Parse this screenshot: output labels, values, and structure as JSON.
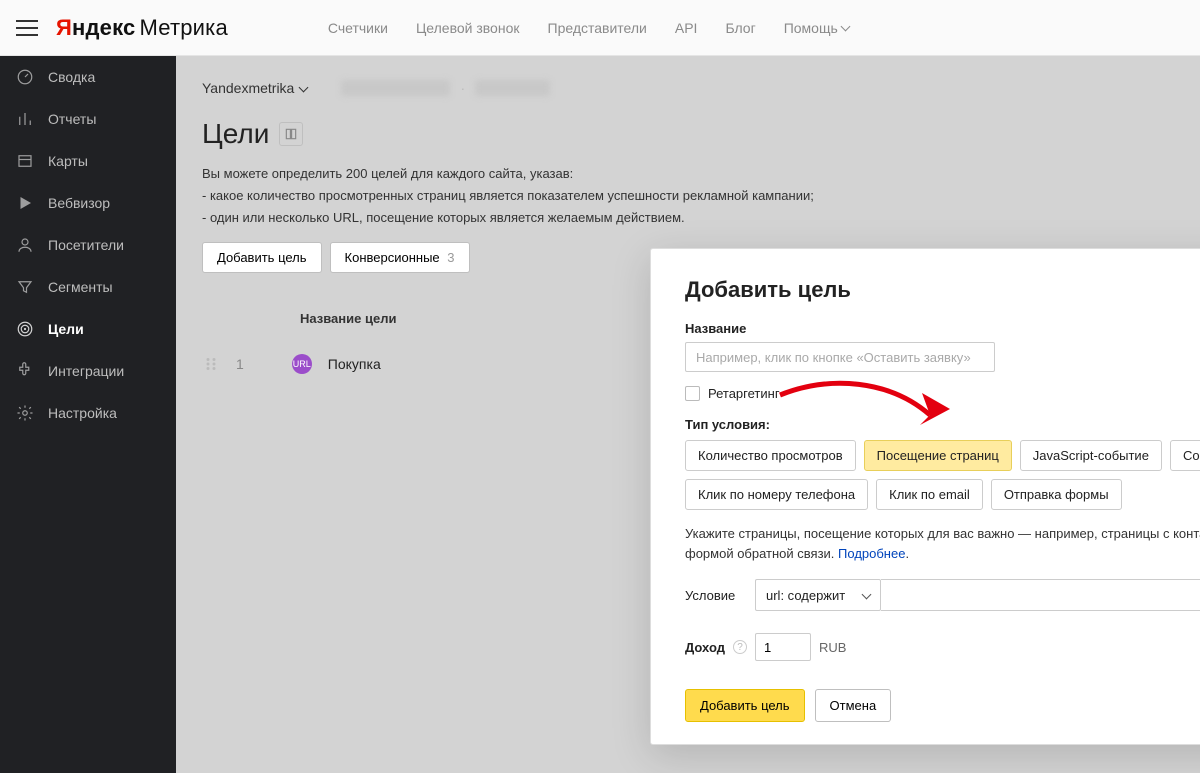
{
  "logo": {
    "y": "Я",
    "andex": "ндекс",
    "metrika": "Метрика"
  },
  "topnav": {
    "counters": "Счетчики",
    "target_call": "Целевой звонок",
    "reps": "Представители",
    "api": "API",
    "blog": "Блог",
    "help": "Помощь"
  },
  "sidebar": {
    "items": [
      {
        "label": "Сводка"
      },
      {
        "label": "Отчеты"
      },
      {
        "label": "Карты"
      },
      {
        "label": "Вебвизор"
      },
      {
        "label": "Посетители"
      },
      {
        "label": "Сегменты"
      },
      {
        "label": "Цели"
      },
      {
        "label": "Интеграции"
      },
      {
        "label": "Настройка"
      }
    ]
  },
  "breadcrumb": {
    "counter": "Yandexmetrika",
    "blur1": "xxxxxx@xxxxx.xx",
    "sep": "·",
    "blur2": "XXXXXXXX"
  },
  "page": {
    "title": "Цели",
    "intro": "Вы можете определить 200 целей для каждого сайта, указав:",
    "bullet1": "-  какое количество просмотренных страниц является показателем успешности рекламной кампании;",
    "bullet2": "-  один или несколько URL, посещение которых является желаемым действием."
  },
  "buttons": {
    "add_goal": "Добавить цель",
    "conversion": "Конверсионные",
    "conversion_count": "3"
  },
  "table": {
    "header_name": "Название цели",
    "row1_index": "1",
    "row1_name": "Покупка",
    "row1_badge": "URL"
  },
  "modal": {
    "title": "Добавить цель",
    "name_label": "Название",
    "name_placeholder": "Например, клик по кнопке «Оставить заявку»",
    "retarget": "Ретаргетинг",
    "cond_type_label": "Тип условия:",
    "pills": {
      "views": "Количество просмотров",
      "pages": "Посещение страниц",
      "js": "JavaScript-событие",
      "composite": "Составная цель",
      "phone": "Клик по номеру телефона",
      "email": "Клик по email",
      "form": "Отправка формы"
    },
    "hint_a": "Укажите страницы, посещение которых для вас важно — например, страницы с контактами или с формой обратной связи. ",
    "hint_link": "Подробнее",
    "hint_dot": ".",
    "cond_label": "Условие",
    "select_value": "url: содержит",
    "plus": "+",
    "income_label": "Доход",
    "income_value": "1",
    "income_currency": "RUB",
    "submit": "Добавить цель",
    "cancel": "Отмена"
  }
}
